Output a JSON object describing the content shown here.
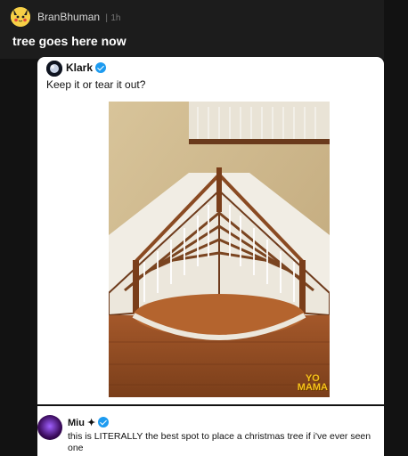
{
  "post": {
    "username": "BranBhuman",
    "separator": "|",
    "age": "1h",
    "title": "tree goes here now"
  },
  "tweet": {
    "name": "Klark",
    "caption": "Keep it or tear it out?",
    "watermark_line1": "YO",
    "watermark_line2": "MAMA"
  },
  "reply": {
    "name": "Miu",
    "name_symbol": "✦",
    "text": "this is LITERALLY the best spot to place a christmas tree if i've ever seen",
    "text_continued": "one"
  },
  "colors": {
    "background": "#121212",
    "verified": "#1d9bf0",
    "watermark": "#f6c21b"
  }
}
